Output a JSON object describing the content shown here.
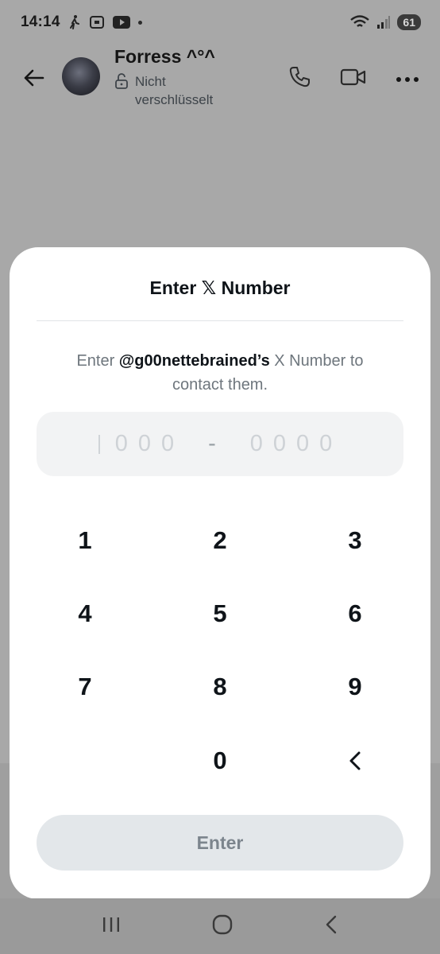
{
  "status_bar": {
    "time": "14:14",
    "battery": "61"
  },
  "chat_header": {
    "contact_name": "Forress ^°^",
    "encryption_status": "Nicht verschlüsselt"
  },
  "modal": {
    "title": "Enter 𝕏 Number",
    "instruction_prefix": "Enter ",
    "instruction_handle": "@g00nettebrained’s",
    "instruction_suffix": " X Number to contact them.",
    "placeholder_part1": "000",
    "placeholder_sep": "-",
    "placeholder_part2": "0000",
    "keys": [
      "1",
      "2",
      "3",
      "4",
      "5",
      "6",
      "7",
      "8",
      "9",
      "0"
    ],
    "enter_label": "Enter"
  },
  "icons": {
    "back": "arrow-left-icon",
    "lock": "unlock-icon",
    "call": "phone-icon",
    "video": "video-icon",
    "more": "more-horizontal-icon",
    "backspace": "chevron-left-icon"
  }
}
